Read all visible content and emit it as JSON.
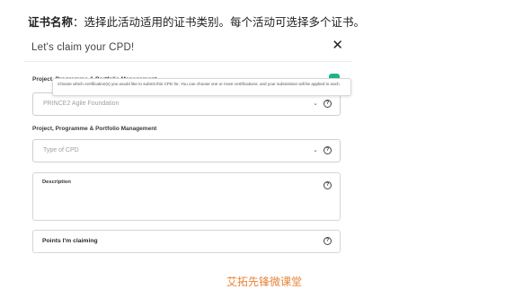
{
  "caption": {
    "bold": "证书名称",
    "rest": "：选择此活动适用的证书类别。每个活动可选择多个证书。"
  },
  "modal": {
    "title": "Let's claim your CPD!",
    "close_symbol": "✕"
  },
  "certification": {
    "label": "Project, Programme & Portfolio Management",
    "selected": "PRINCE2 Agile Foundation",
    "tooltip": "Choose which certification(s) you would like to submit this CPD for. You can choose one or more certifications, and your submission will be applied to each."
  },
  "cpd_type": {
    "label": "Project, Programme & Portfolio Management",
    "placeholder": "Type of CPD"
  },
  "description": {
    "label": "Description"
  },
  "points": {
    "label": "Points I'm claiming"
  },
  "icons": {
    "chevron": "chevron-down-icon",
    "help": "help-circle-icon",
    "close": "close-icon"
  },
  "colors": {
    "accent_green": "#1fb38a",
    "watermark": "#e8843a"
  },
  "watermark": "艾拓先锋微课堂"
}
